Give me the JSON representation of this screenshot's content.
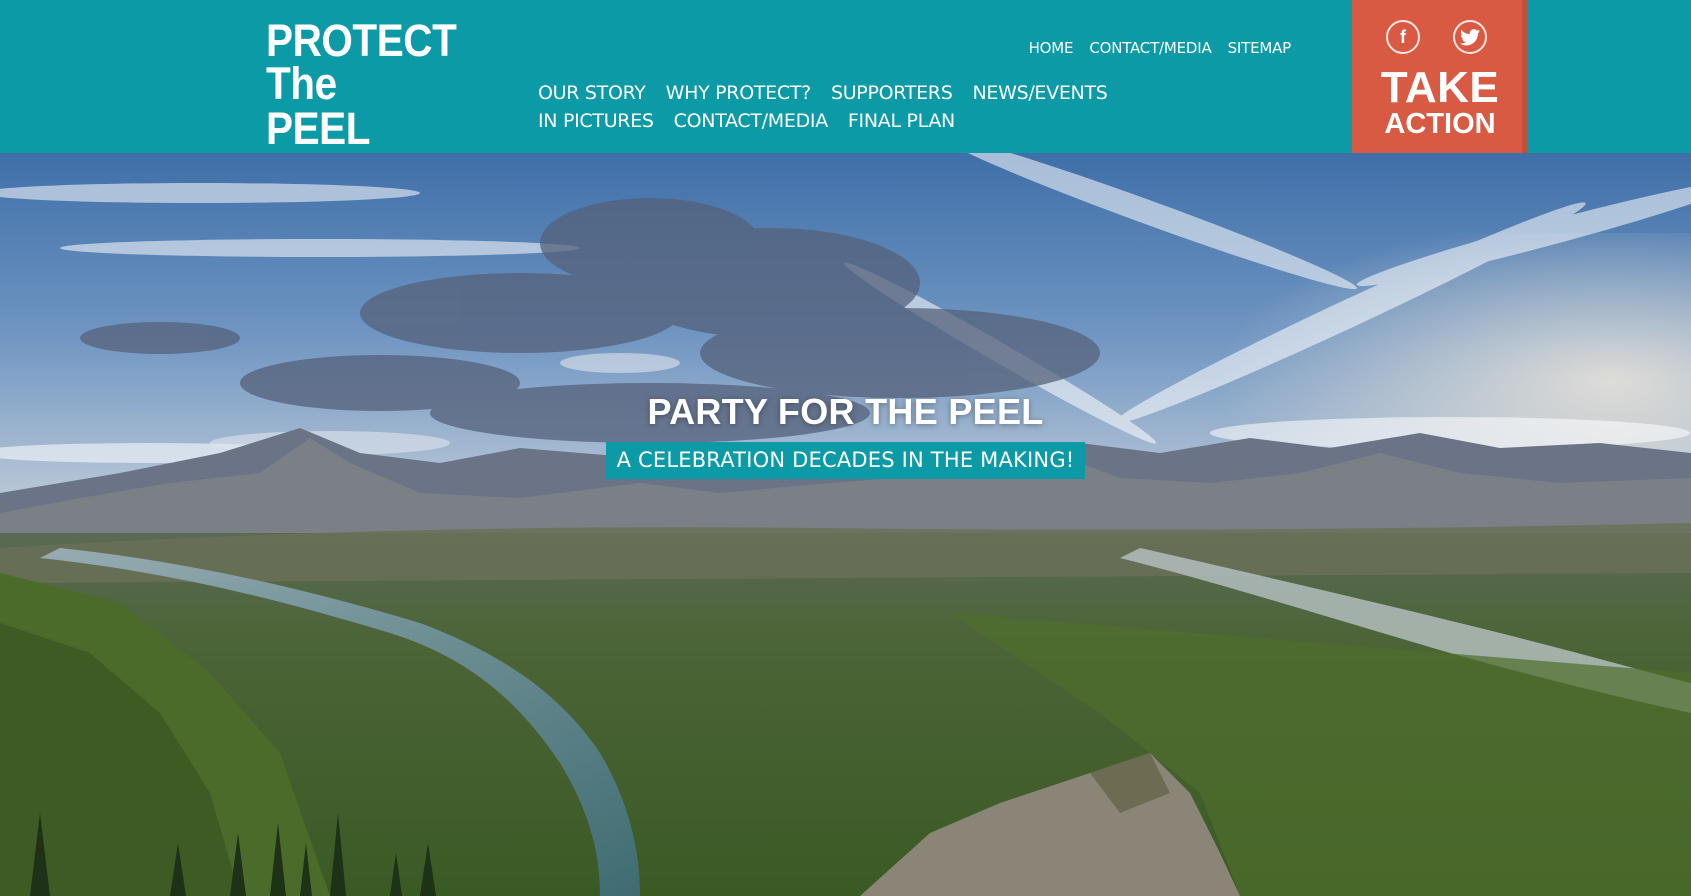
{
  "logo": {
    "line1": "PROTECT",
    "line2": "The PEEL"
  },
  "utility_nav": [
    "HOME",
    "CONTACT/MEDIA",
    "SITEMAP"
  ],
  "main_nav": [
    "OUR STORY",
    "WHY PROTECT?",
    "SUPPORTERS",
    "NEWS/EVENTS",
    "IN PICTURES",
    "CONTACT/MEDIA",
    "FINAL PLAN"
  ],
  "take_action": {
    "line1": "TAKE",
    "line2": "ACTION"
  },
  "social": {
    "facebook_glyph": "f"
  },
  "hero": {
    "title": "PARTY FOR THE PEEL",
    "subtitle": "A CELEBRATION DECADES IN THE MAKING!"
  },
  "colors": {
    "teal": "#0c9ba6",
    "action": "#d95a43"
  },
  "icons": [
    "facebook-icon",
    "twitter-icon"
  ]
}
